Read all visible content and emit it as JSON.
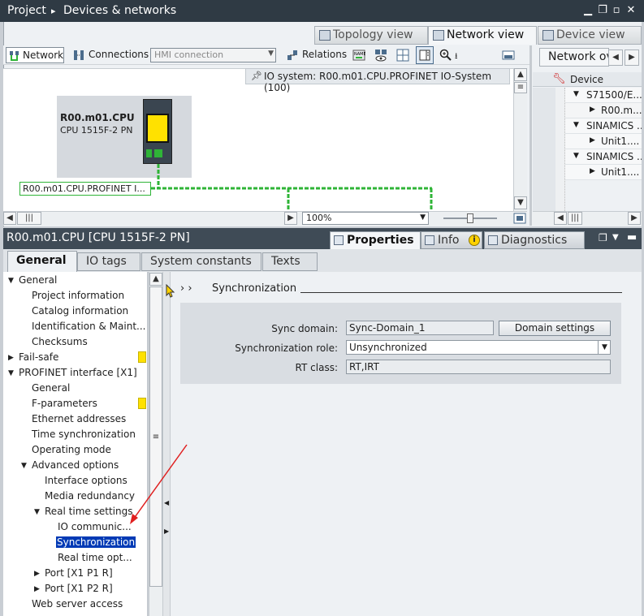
{
  "titlebar": {
    "project": "Project",
    "separator": "▸",
    "section": "Devices & networks"
  },
  "view_tabs": {
    "topology": "Topology view",
    "network": "Network view",
    "device": "Device view"
  },
  "toolbar": {
    "network": "Network",
    "connections": "Connections",
    "hmi_connection": "HMI connection",
    "relations": "Relations"
  },
  "canvas": {
    "io_system": "IO system: R00.m01.CPU.PROFINET IO-System (100)",
    "cpu_name": "R00.m01.CPU",
    "cpu_type": "CPU 1515F-2 PN",
    "profinet_label": "R00.m01.CPU.PROFINET I..."
  },
  "zoom": "100%",
  "overview": {
    "tab": "Network overview",
    "column": "Device",
    "rows": [
      {
        "label": "S71500/E...",
        "level": 0
      },
      {
        "label": "R00.m...",
        "level": 1
      },
      {
        "label": "SINAMICS ...",
        "level": 0
      },
      {
        "label": "Unit1....",
        "level": 1
      },
      {
        "label": "SINAMICS ...",
        "level": 0
      },
      {
        "label": "Unit1....",
        "level": 1
      }
    ]
  },
  "inspector": {
    "title": "R00.m01.CPU [CPU 1515F-2 PN]",
    "tabs": {
      "properties": "Properties",
      "info": "Info",
      "diagnostics": "Diagnostics"
    },
    "subtabs": {
      "general": "General",
      "io_tags": "IO tags",
      "system_constants": "System constants",
      "texts": "Texts"
    }
  },
  "nav": {
    "general": "General",
    "project_information": "Project information",
    "catalog_information": "Catalog information",
    "identification": "Identification & Maint...",
    "checksums": "Checksums",
    "fail_safe": "Fail-safe",
    "profinet_interface": "PROFINET interface [X1]",
    "pn_general": "General",
    "f_parameters": "F-parameters",
    "ethernet_addresses": "Ethernet addresses",
    "time_sync": "Time synchronization",
    "operating_mode": "Operating mode",
    "advanced_options": "Advanced options",
    "interface_options": "Interface options",
    "media_redundancy": "Media redundancy",
    "real_time_settings": "Real time settings",
    "io_communication": "IO communic...",
    "synchronization": "Synchronization",
    "real_time_options": "Real time opt...",
    "port1": "Port [X1 P1 R]",
    "port2": "Port [X1 P2 R]",
    "web_server": "Web server access"
  },
  "content": {
    "breadcrumb": "› ›",
    "section_title": "Synchronization",
    "sync_domain_label": "Sync domain:",
    "sync_domain_value": "Sync-Domain_1",
    "domain_settings_button": "Domain settings",
    "sync_role_label": "Synchronization role:",
    "sync_role_value": "Unsynchronized",
    "rt_class_label": "RT class:",
    "rt_class_value": "RT,IRT"
  },
  "colors": {
    "titlebar": "#2f3a44",
    "inspector_bar": "#3f4b56",
    "selection": "#003ab5",
    "profinet_green": "#2fb437",
    "status_yellow": "#ffe100",
    "annotation_arrow": "#e02020"
  }
}
